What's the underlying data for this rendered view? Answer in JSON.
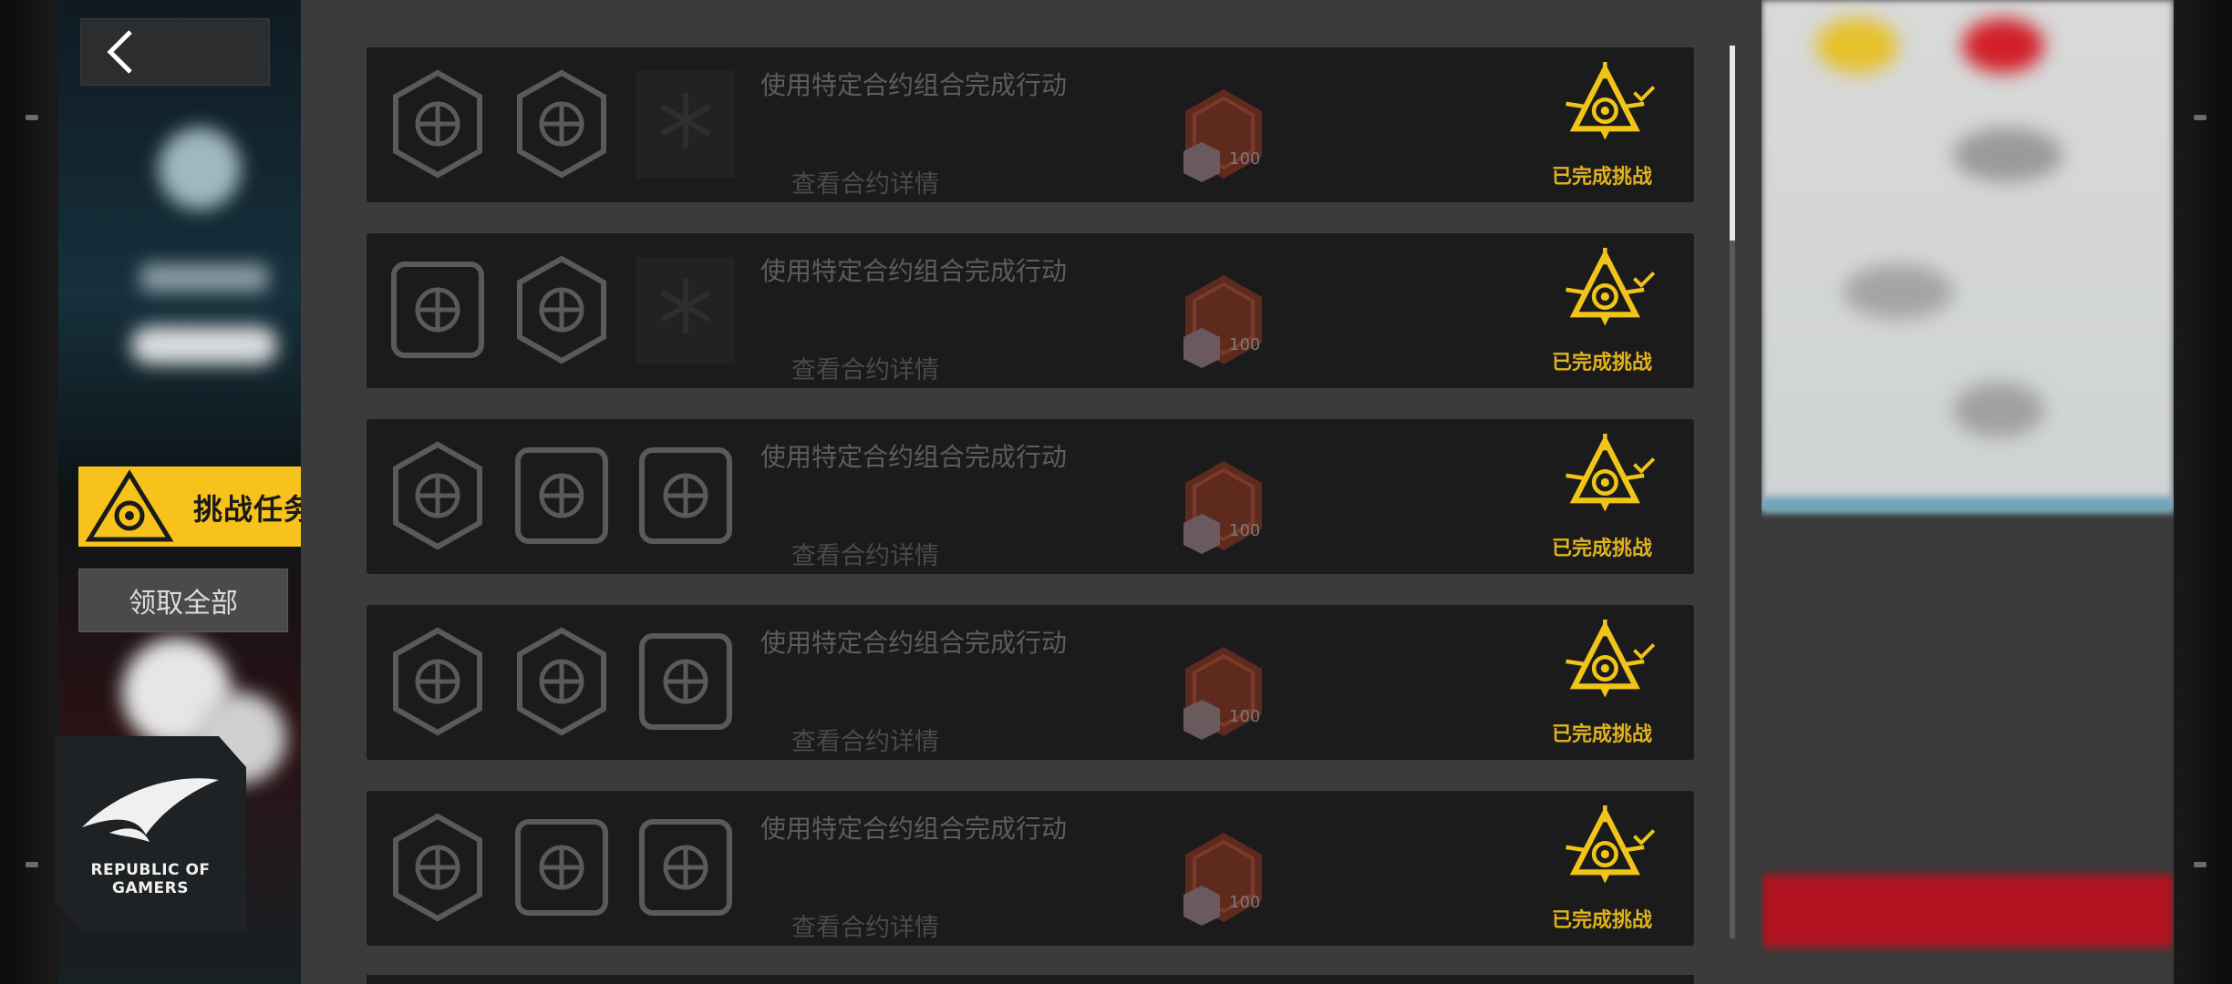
{
  "nav": {
    "back_label": "<",
    "challenge_tab_label": "挑战任务",
    "collect_all_label": "领取全部"
  },
  "badge": {
    "line1": "REPUBLIC OF",
    "line2": "GAMERS"
  },
  "colors": {
    "accent": "#f6c21b",
    "panel": "#3a3b3c",
    "card": "#1b1b1b",
    "done_text": "#e0b21e"
  },
  "challenges": [
    {
      "description": "使用特定合约组合完成行动",
      "detail_link": "查看合约详情",
      "reward_amount": "100",
      "status": "已完成挑战",
      "icons": [
        "helmet-icon",
        "target-cross-icon",
        "snowflake-locked-icon"
      ]
    },
    {
      "description": "使用特定合约组合完成行动",
      "detail_link": "查看合约详情",
      "reward_amount": "100",
      "status": "已完成挑战",
      "icons": [
        "weapon-parts-icon",
        "diamond-icon",
        "snowflake-locked-icon"
      ]
    },
    {
      "description": "使用特定合约组合完成行动",
      "detail_link": "查看合约详情",
      "reward_amount": "100",
      "status": "已完成挑战",
      "icons": [
        "crossed-guns-icon",
        "grid-x-icon",
        "globe-no-icon"
      ]
    },
    {
      "description": "使用特定合约组合完成行动",
      "detail_link": "查看合约详情",
      "reward_amount": "100",
      "status": "已完成挑战",
      "icons": [
        "rotate-arrows-icon",
        "target-cross-icon",
        "boot-water-icon"
      ]
    },
    {
      "description": "使用特定合约组合完成行动",
      "detail_link": "查看合约详情",
      "reward_amount": "100",
      "status": "已完成挑战",
      "icons": [
        "tech-plate-icon",
        "crossed-swords-icon",
        "knife-clock-icon"
      ]
    }
  ]
}
